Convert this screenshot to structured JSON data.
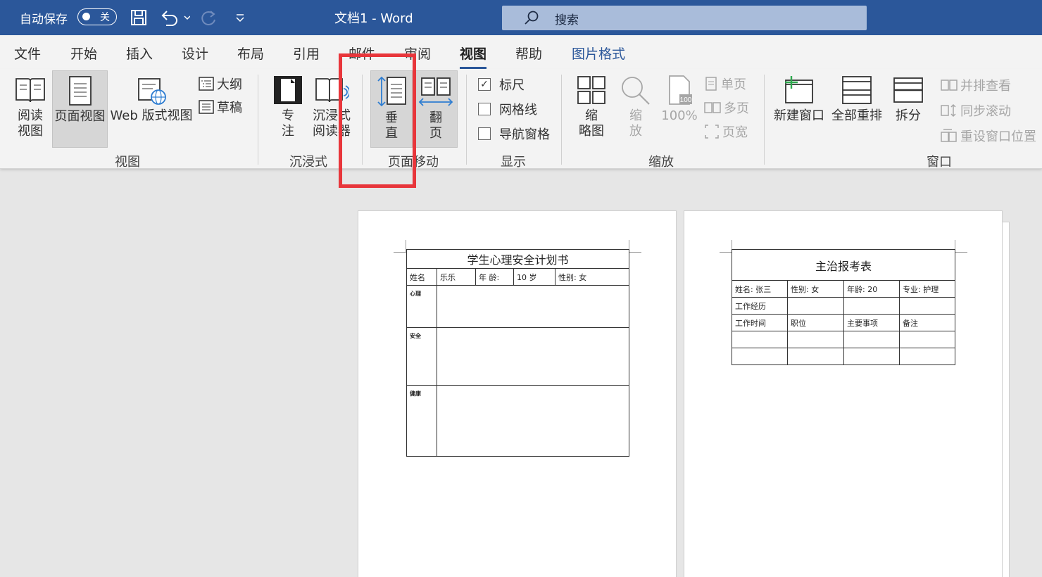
{
  "titlebar": {
    "autosave_label": "自动保存",
    "autosave_state": "关",
    "doc_title": "文档1  -  Word",
    "search_placeholder": "搜索"
  },
  "menu_tabs": [
    "文件",
    "开始",
    "插入",
    "设计",
    "布局",
    "引用",
    "邮件",
    "审阅",
    "视图",
    "帮助",
    "图片格式"
  ],
  "active_tab": "视图",
  "ribbon": {
    "views": {
      "read": [
        "阅读",
        "视图"
      ],
      "page_view": "页面视图",
      "web_view": "Web 版式视图",
      "outline": "大纲",
      "draft": "草稿",
      "group": "视图"
    },
    "immersive": {
      "focus": [
        "专",
        "注"
      ],
      "reader": [
        "沉浸式",
        "阅读器"
      ],
      "group": "沉浸式"
    },
    "page_movement": {
      "vertical": [
        "垂",
        "直"
      ],
      "side": [
        "翻",
        "页"
      ],
      "group": "页面移动"
    },
    "show": {
      "ruler": "标尺",
      "gridlines": "网格线",
      "nav_pane": "导航窗格",
      "ruler_checked": true,
      "group": "显示"
    },
    "zoom": {
      "thumbs": [
        "缩",
        "略图"
      ],
      "zoom": [
        "缩",
        "放"
      ],
      "hundred": "100%",
      "one_page": "单页",
      "multi_page": "多页",
      "page_width": "页宽",
      "group": "缩放"
    },
    "window": {
      "new_window": "新建窗口",
      "arrange_all": "全部重排",
      "split": "拆分",
      "side_by_side": "并排查看",
      "sync_scroll": "同步滚动",
      "reset_pos": "重设窗口位置",
      "group": "窗口"
    }
  },
  "page1": {
    "title": "学生心理安全计划书",
    "row1": [
      "姓名",
      "乐乐",
      "年 龄:",
      "10 岁",
      "性别: 女"
    ],
    "sections": [
      "心理",
      "安全",
      "健康"
    ]
  },
  "page2": {
    "title": "主治报考表",
    "row1": [
      "姓名: 张三",
      "性别: 女",
      "年龄: 20",
      "专业: 护理"
    ],
    "row2": "工作经历",
    "row3": [
      "工作时间",
      "职位",
      "主要事项",
      "备注"
    ]
  },
  "colors": {
    "titlebar": "#2b579a",
    "highlight": "#e8363b",
    "ribbon": "#f3f3f3"
  }
}
